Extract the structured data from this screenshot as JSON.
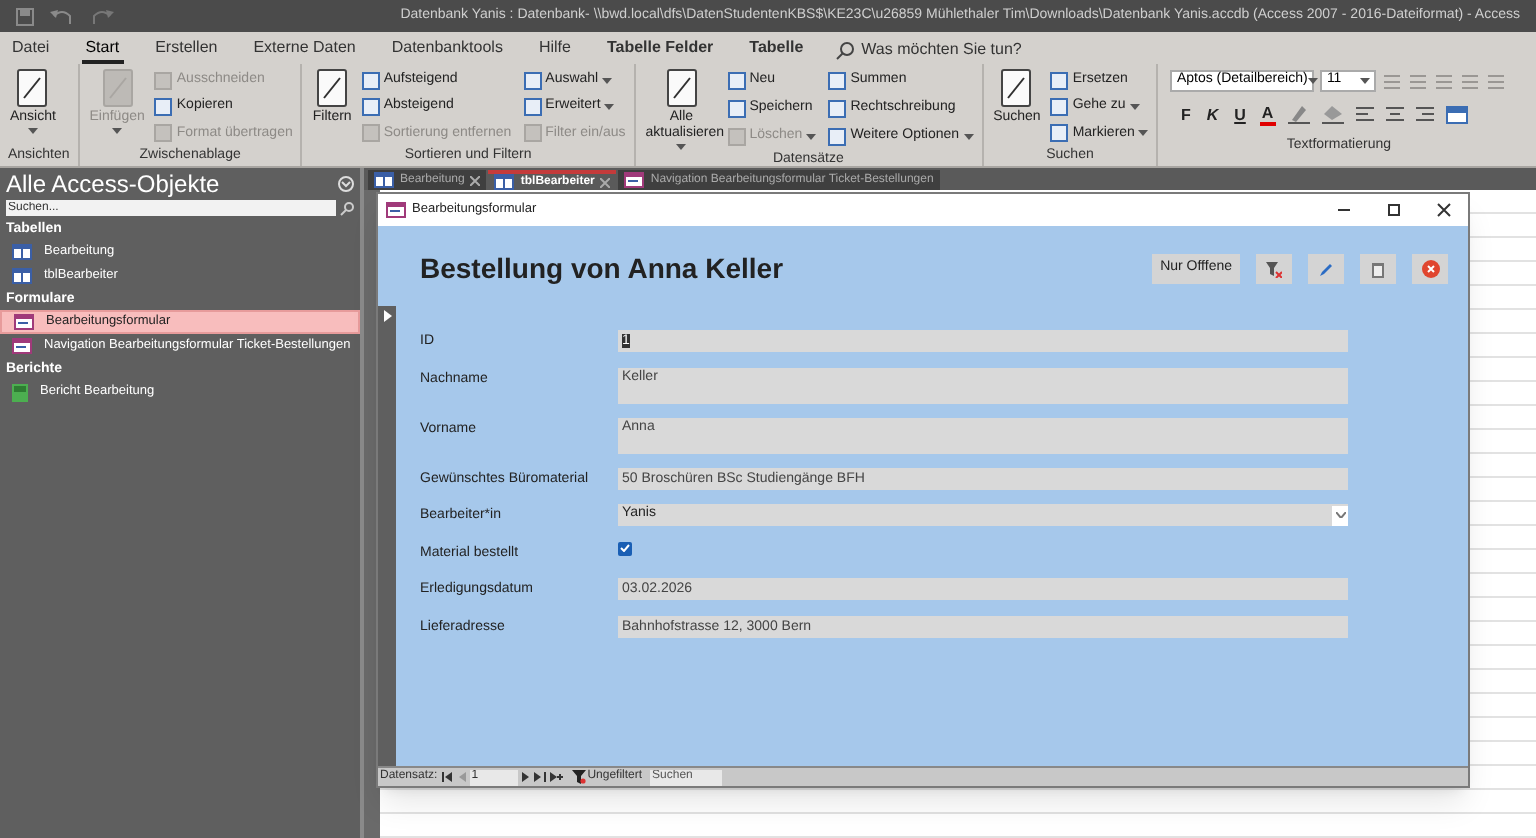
{
  "window": {
    "title": "Datenbank Yanis : Datenbank- \\\\bwd.local\\dfs\\DatenStudentenKBS$\\KE23C\\u26859 Mühlethaler Tim\\Downloads\\Datenbank Yanis.accdb (Access 2007 - 2016-Dateiformat)  -  Access"
  },
  "menu_tabs": [
    {
      "label": "Datei",
      "selected": false,
      "contextual": false
    },
    {
      "label": "Start",
      "selected": true,
      "contextual": false
    },
    {
      "label": "Erstellen",
      "selected": false,
      "contextual": false
    },
    {
      "label": "Externe Daten",
      "selected": false,
      "contextual": false
    },
    {
      "label": "Datenbanktools",
      "selected": false,
      "contextual": false
    },
    {
      "label": "Hilfe",
      "selected": false,
      "contextual": false
    },
    {
      "label": "Tabelle Felder",
      "selected": false,
      "contextual": true
    },
    {
      "label": "Tabelle",
      "selected": false,
      "contextual": true
    }
  ],
  "tell_me": {
    "placeholder": "Was möchten Sie tun?"
  },
  "ribbon_groups": [
    {
      "label": "Ansichten",
      "large": [
        {
          "label": "Ansicht",
          "disabled": false,
          "dropdown": true
        }
      ]
    },
    {
      "label": "Zwischenablage",
      "large": [
        {
          "label": "Einfügen",
          "disabled": true,
          "dropdown": true
        }
      ],
      "small": [
        {
          "label": "Ausschneiden",
          "disabled": true,
          "dropdown": false
        },
        {
          "label": "Kopieren",
          "disabled": false,
          "dropdown": false
        },
        {
          "label": "Format übertragen",
          "disabled": true,
          "dropdown": false
        }
      ]
    },
    {
      "label": "Sortieren und Filtern",
      "large": [
        {
          "label": "Filtern",
          "disabled": false,
          "dropdown": false
        }
      ],
      "small": [
        {
          "label": "Aufsteigend",
          "disabled": false,
          "dropdown": false
        },
        {
          "label": "Absteigend",
          "disabled": false,
          "dropdown": false
        },
        {
          "label": "Sortierung entfernen",
          "disabled": true,
          "dropdown": false
        },
        {
          "label": "Auswahl",
          "disabled": false,
          "dropdown": true
        },
        {
          "label": "Erweitert",
          "disabled": false,
          "dropdown": true
        },
        {
          "label": "Filter ein/aus",
          "disabled": true,
          "dropdown": false
        }
      ]
    },
    {
      "label": "Datensätze",
      "large": [
        {
          "label": "Alle aktualisieren",
          "disabled": false,
          "dropdown": true
        }
      ],
      "small": [
        {
          "label": "Neu",
          "disabled": false,
          "dropdown": false
        },
        {
          "label": "Speichern",
          "disabled": false,
          "dropdown": false
        },
        {
          "label": "Löschen",
          "disabled": true,
          "dropdown": true
        },
        {
          "label": "Summen",
          "disabled": false,
          "dropdown": false
        },
        {
          "label": "Rechtschreibung",
          "disabled": false,
          "dropdown": false
        },
        {
          "label": "Weitere Optionen",
          "disabled": false,
          "dropdown": true
        }
      ]
    },
    {
      "label": "Suchen",
      "large": [
        {
          "label": "Suchen",
          "disabled": false,
          "dropdown": false
        }
      ],
      "small": [
        {
          "label": "Ersetzen",
          "disabled": false,
          "dropdown": false
        },
        {
          "label": "Gehe zu",
          "disabled": false,
          "dropdown": true
        },
        {
          "label": "Markieren",
          "disabled": false,
          "dropdown": true
        }
      ]
    }
  ],
  "text_formatting": {
    "label": "Textformatierung",
    "font_name": "Aptos (Detailbereich)",
    "font_size": "11",
    "format_buttons": [
      "F",
      "K",
      "U",
      "A"
    ]
  },
  "nav_pane": {
    "title": "Alle Access-Objekte",
    "search_placeholder": "Suchen...",
    "sections": [
      {
        "label": "Tabellen",
        "items": [
          {
            "label": "Bearbeitung",
            "kind": "table",
            "selected": false
          },
          {
            "label": "tblBearbeiter",
            "kind": "table",
            "selected": false
          }
        ]
      },
      {
        "label": "Formulare",
        "items": [
          {
            "label": "Bearbeitungsformular",
            "kind": "form",
            "selected": true
          },
          {
            "label": "Navigation Bearbeitungsformular Ticket-Bestellungen",
            "kind": "form",
            "selected": false
          }
        ]
      },
      {
        "label": "Berichte",
        "items": [
          {
            "label": "Bericht Bearbeitung",
            "kind": "report",
            "selected": false
          }
        ]
      }
    ]
  },
  "document_tabs": [
    {
      "label": "Bearbeitung",
      "kind": "table",
      "selected": false
    },
    {
      "label": "tblBearbeiter",
      "kind": "table",
      "selected": true
    },
    {
      "label": "Navigation Bearbeitungsformular Ticket-Bestellungen",
      "kind": "form",
      "selected": false
    }
  ],
  "form": {
    "title": "Bearbeitungsformular",
    "heading": "Bestellung von Anna Keller",
    "buttons": [
      {
        "kind": "text",
        "label": "Nur Offfene"
      },
      {
        "kind": "clear-filter"
      },
      {
        "kind": "edit"
      },
      {
        "kind": "delete"
      },
      {
        "kind": "close"
      }
    ],
    "fields": [
      {
        "label": "ID",
        "kind": "text",
        "value": "1",
        "selected": true
      },
      {
        "label": "Nachname",
        "kind": "memo",
        "value": "Keller",
        "selected": false
      },
      {
        "label": "Vorname",
        "kind": "memo",
        "value": "Anna",
        "selected": false
      },
      {
        "label": "Gewünschtes Büromaterial",
        "kind": "text",
        "value": "50 Broschüren BSc  Studiengänge BFH",
        "selected": false
      },
      {
        "label": "Bearbeiter*in",
        "kind": "combo",
        "value": "Yanis",
        "selected": false
      },
      {
        "label": "Material bestellt",
        "kind": "checkbox",
        "checked": true
      },
      {
        "label": "Erledigungsdatum",
        "kind": "text",
        "value": "03.02.2026",
        "selected": false
      },
      {
        "label": "Lieferadresse",
        "kind": "text",
        "value": "Bahnhofstrasse 12, 3000 Bern",
        "selected": false
      }
    ]
  },
  "record_navigation": {
    "label": "Datensatz:",
    "current": "1",
    "filter_status": "Ungefiltert",
    "search_placeholder": "Suchen"
  }
}
